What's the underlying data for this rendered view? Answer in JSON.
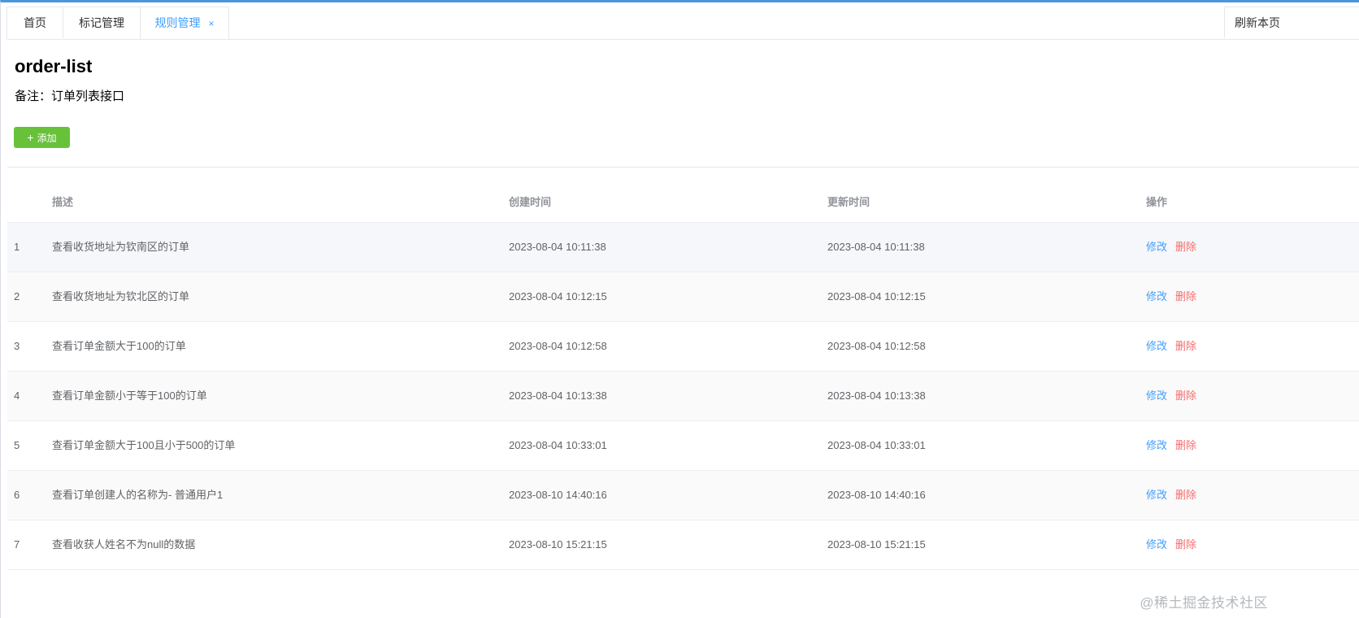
{
  "tabs": [
    {
      "label": "首页"
    },
    {
      "label": "标记管理"
    },
    {
      "label": "规则管理",
      "close_glyph": "×"
    }
  ],
  "refresh_tab": {
    "label": "刷新本页"
  },
  "page": {
    "title": "order-list",
    "remark": "备注：订单列表接口",
    "add_button": {
      "icon": "plus-icon",
      "glyph": "+",
      "label": "添加"
    }
  },
  "table": {
    "columns": [
      "描述",
      "创建时间",
      "更新时间",
      "操作"
    ],
    "rows": [
      {
        "index": "1",
        "description": "查看收货地址为钦南区的订单",
        "created": "2023-08-04 10:11:38",
        "updated": "2023-08-04 10:11:38"
      },
      {
        "index": "2",
        "description": "查看收货地址为钦北区的订单",
        "created": "2023-08-04 10:12:15",
        "updated": "2023-08-04 10:12:15"
      },
      {
        "index": "3",
        "description": "查看订单金额大于100的订单",
        "created": "2023-08-04 10:12:58",
        "updated": "2023-08-04 10:12:58"
      },
      {
        "index": "4",
        "description": "查看订单金额小于等于100的订单",
        "created": "2023-08-04 10:13:38",
        "updated": "2023-08-04 10:13:38"
      },
      {
        "index": "5",
        "description": "查看订单金额大于100且小于500的订单",
        "created": "2023-08-04 10:33:01",
        "updated": "2023-08-04 10:33:01"
      },
      {
        "index": "6",
        "description": "查看订单创建人的名称为- 普通用户1",
        "created": "2023-08-10 14:40:16",
        "updated": "2023-08-10 14:40:16"
      },
      {
        "index": "7",
        "description": "查看收获人姓名不为null的数据",
        "created": "2023-08-10 15:21:15",
        "updated": "2023-08-10 15:21:15"
      }
    ],
    "edit_label": "修改",
    "delete_label": "删除"
  },
  "watermark": "@稀土掘金技术社区",
  "colors": {
    "accent": "#409eff",
    "success": "#67c23a",
    "danger": "#f56c6c",
    "top_border": "#4a96dc"
  }
}
